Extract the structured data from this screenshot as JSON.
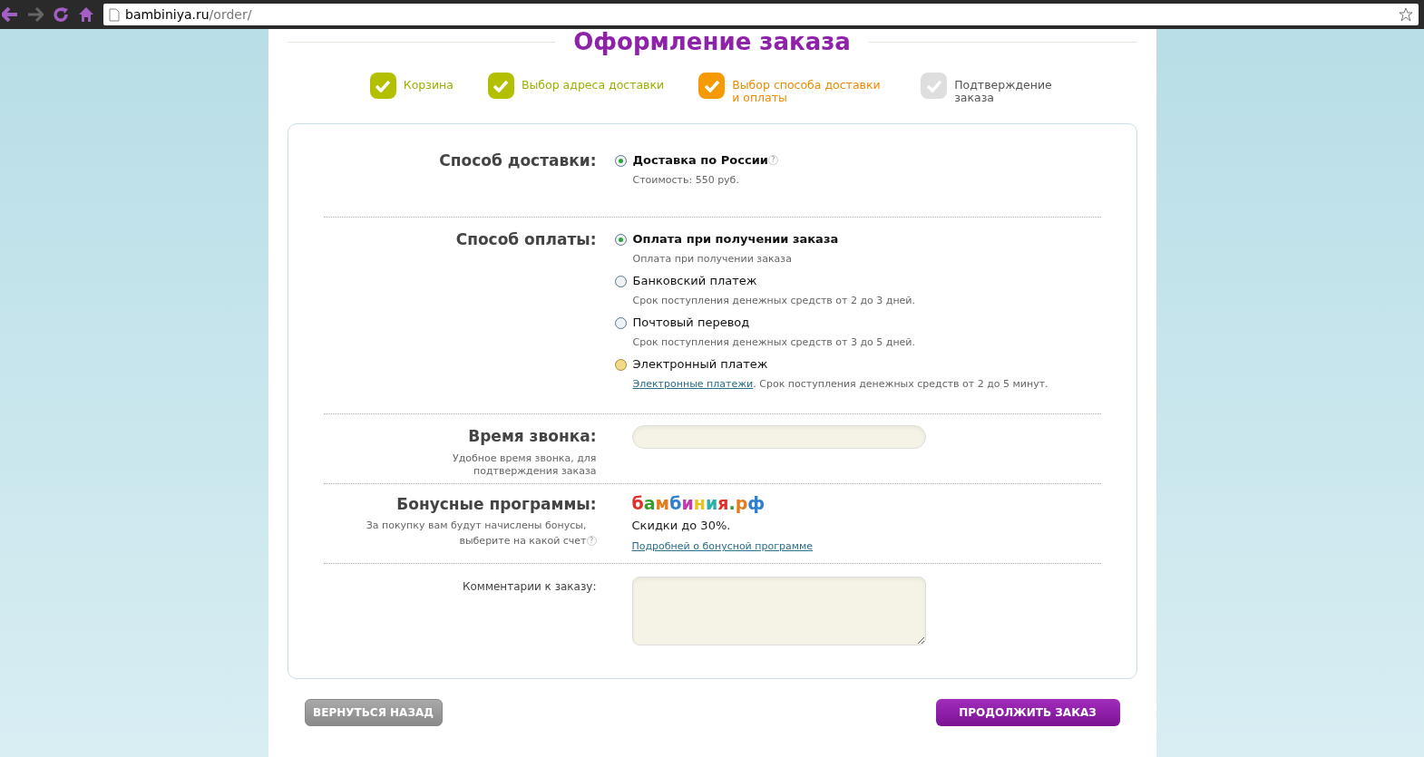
{
  "browser": {
    "address_host": "bambiniya.ru",
    "address_path": "/order/"
  },
  "page_title": "Оформление заказа",
  "steps": [
    {
      "label": "Корзина",
      "kind": "done"
    },
    {
      "label": "Выбор адреса доставки",
      "kind": "done"
    },
    {
      "label": "Выбор способа доставки и оплаты",
      "kind": "current"
    },
    {
      "label": "Подтверждение заказа",
      "kind": "pending"
    }
  ],
  "delivery": {
    "label": "Способ доставки:",
    "options": [
      {
        "title": "Доставка по России",
        "help": "?",
        "note": "Стоимость: 550 руб.",
        "selected": true,
        "kind": "plain"
      }
    ]
  },
  "payment": {
    "label": "Способ оплаты:",
    "options": [
      {
        "title": "Оплата при получении заказа",
        "note": "Оплата при получении заказа",
        "selected": true,
        "kind": "plain"
      },
      {
        "title": "Банковский платеж",
        "note": "Срок поступления денежных средств от 2 до 3 дней.",
        "selected": false,
        "kind": "plain"
      },
      {
        "title": "Почтовый перевод",
        "note": "Срок поступления денежных средств от 3 до 5 дней.",
        "selected": false,
        "kind": "plain"
      },
      {
        "title": "Электронный платеж",
        "note_link": "Электронные платежи",
        "note": ". Срок поступления денежных средств от 2 до 5 минут.",
        "selected": false,
        "kind": "hover"
      }
    ]
  },
  "call_time": {
    "label": "Время звонка:",
    "hint": "Удобное время звонка, для подтверждения заказа"
  },
  "bonus": {
    "label": "Бонусные программы:",
    "hint": "За покупку вам будут начислены бонусы, выберите на какой счет",
    "help": "?",
    "logo": "бамбиния.рф",
    "discount": "Скидки до 30%.",
    "link": "Подробней о бонусной программе"
  },
  "comment": {
    "label": "Комментарии к заказу:"
  },
  "buttons": {
    "back": "ВЕРНУТЬСЯ НАЗАД",
    "next": "ПРОДОЛЖИТЬ ЗАКАЗ"
  }
}
